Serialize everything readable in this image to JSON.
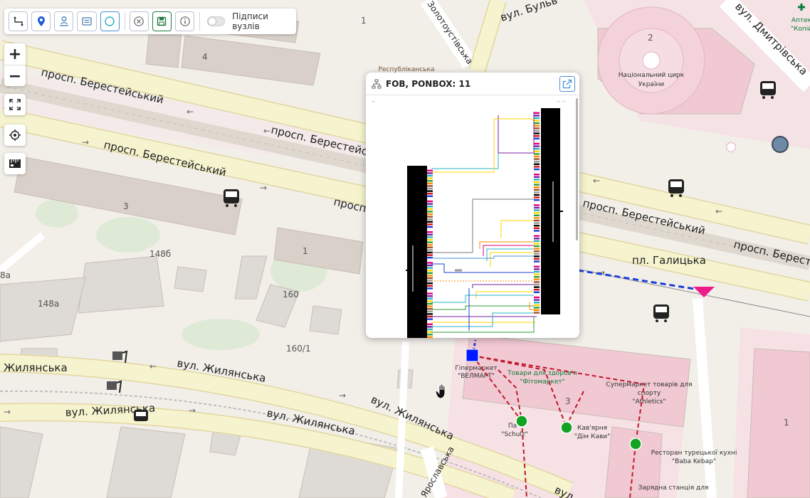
{
  "toolbar": {
    "buttons": [
      {
        "name": "route-tool-button",
        "icon": "route-icon",
        "color": "#333333"
      },
      {
        "name": "marker-tool-button",
        "icon": "map-pin-icon",
        "color": "#1e5bd8"
      },
      {
        "name": "user-location-button",
        "icon": "person-pin-icon",
        "color": "#4a7fb5"
      },
      {
        "name": "card-tool-button",
        "icon": "card-icon",
        "color": "#4a7fb5"
      },
      {
        "name": "circle-tool-button",
        "icon": "circle-icon",
        "color": "#27b3c7"
      },
      {
        "name": "cancel-button",
        "icon": "cancel-icon",
        "color": "#666666"
      },
      {
        "name": "save-button",
        "icon": "save-icon",
        "color": "#1f7a3f"
      },
      {
        "name": "info-button",
        "icon": "info-icon",
        "color": "#666666"
      }
    ],
    "toggle_label": "Підписи вузлів",
    "toggle_on": false
  },
  "zoom": {
    "plus": "+",
    "minus": "−"
  },
  "popup": {
    "title": "FOB, PONBOX: 11",
    "top_left_note": "--",
    "top_right_note": "-- --"
  },
  "map_labels": {
    "streets": {
      "berest1": "просп. Берестейський",
      "berest2": "просп. Берестейський",
      "berest3": "просп. Берестейський",
      "berest4": "просп. Берестейський",
      "berest5": "просп. Берестейський",
      "berest6": "просп. Берест",
      "berest7": "просп. Берест",
      "zhyl1": "Жилянська",
      "zhyl2": "вул. Жилянська",
      "zhyl3": "вул. Жилянська",
      "zhyl4": "вул. Жилянська",
      "zhyl5": "вул. Жилянська",
      "zhyl6": "вул. Жилянська",
      "zolot": "Золотоустівська",
      "bulv": "вул. Бульв",
      "dmytr": "вул. Дмитрівська",
      "galytska": "пл. Галицька",
      "vul_bottom": "вул",
      "yaroska": "Ярославська"
    },
    "numbers": {
      "n1a": "1",
      "n4": "4",
      "n2": "2",
      "n3": "3",
      "n148b": "148б",
      "n1b": "1",
      "n148a": "148а",
      "n160": "160",
      "n1601": "160/1",
      "n3b": "3",
      "n1c": "1",
      "n8a": "8а"
    },
    "pois": {
      "republikanska": "Республіканська",
      "circus1": "Національний цирк",
      "circus2": "України",
      "apteka1": "Аптек",
      "apteka2": "\"Копій",
      "velmart1": "Гіпермаркет",
      "velmart2": "\"ВЕЛМАРТ\"",
      "fito1": "Товари для здоров'я",
      "fito2": "\"Фітомаркет\"",
      "athl1": "Супермаркет товарів для",
      "athl2": "спорту",
      "athl3": "\"Athletics\"",
      "schulz1": "Па",
      "schulz2": "\"Schulz\"",
      "kava1": "Кав'ярня",
      "kava2": "\"Дім Кави\"",
      "kebab1": "Ресторан турецької кухні",
      "kebab2": "\"Baba Kebap\"",
      "charging": "Зарядна станція для"
    }
  },
  "colors": {
    "road_fill": "#f6f3cf",
    "road_stroke": "#e2d6a0",
    "building": "#d9d0c9",
    "building_pink": "#f6dde3",
    "green": "#dbe9d3",
    "network_red": "#c0172b",
    "network_blue": "#1a3fd9",
    "node_green": "#11a321",
    "node_box": "#0018ff",
    "triangle": "#ee1b8d"
  }
}
